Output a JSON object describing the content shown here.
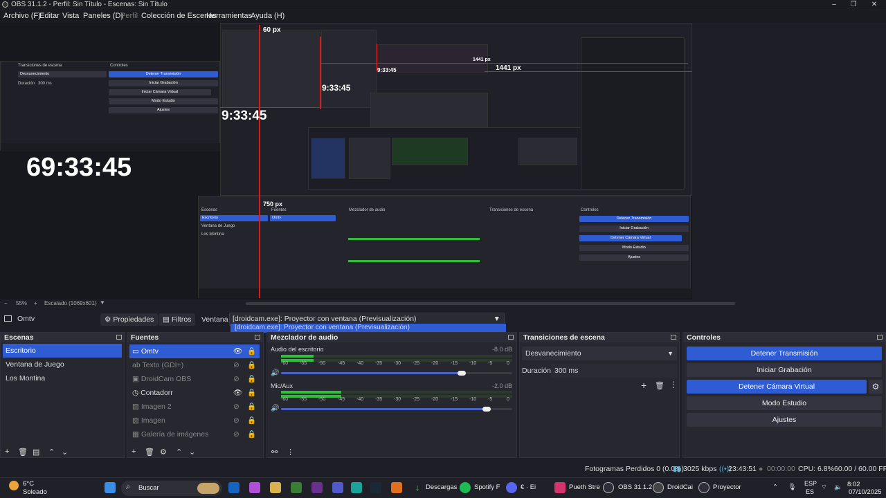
{
  "window": {
    "title": "OBS 31.1.2 - Perfil: Sin Título - Escenas: Sin Título"
  },
  "menu": [
    "Archivo (F)",
    "Editar",
    "Vista",
    "Paneles (D)",
    "Perfil",
    "Colección de Escenas",
    "Herramientas",
    "Ayuda (H)"
  ],
  "preview": {
    "clock_large": "69:33:45",
    "clock_medium": "9:33:45",
    "clock_small": "9:33:45",
    "clock_tiny": "9:33:45",
    "measure_top": "60 px",
    "measure_right": "1441 px",
    "measure_bottom": "750 px",
    "measure_mid": "1441 px"
  },
  "zoom": {
    "level": "55%",
    "scaling": "Escalado (1069x601)"
  },
  "context": {
    "source_name": "Omtv",
    "properties_label": "Propiedades",
    "filters_label": "Filtros",
    "window_label": "Ventana",
    "window_value": "[droidcam.exe]: Proyector con ventana (Previsualización)",
    "dropdown_option": "[droidcam.exe]: Proyector con ventana (Previsualización)"
  },
  "docks": {
    "scenes": {
      "title": "Escenas",
      "items": [
        "Escritorio",
        "Ventana de Juego",
        "Los Montina"
      ]
    },
    "sources": {
      "title": "Fuentes",
      "items": [
        {
          "name": "Omtv",
          "icon": "monitor-icon"
        },
        {
          "name": "Texto (GDI+)",
          "icon": "text-icon"
        },
        {
          "name": "DroidCam OBS",
          "icon": "camera-icon"
        },
        {
          "name": "Contadorr",
          "icon": "clock-icon"
        },
        {
          "name": "Imagen 2",
          "icon": "image-icon"
        },
        {
          "name": "Imagen",
          "icon": "image-icon"
        },
        {
          "name": "Galería de imágenes",
          "icon": "gallery-icon"
        }
      ]
    },
    "mixer": {
      "title": "Mezclador de audio",
      "channels": [
        {
          "name": "Audio del escritorio",
          "db": "-8.0 dB",
          "level": 0.14,
          "volume": 0.78
        },
        {
          "name": "Mic/Aux",
          "db": "-2.0 dB",
          "level": 0.26,
          "volume": 0.89
        }
      ],
      "ticks": [
        "-60",
        "-55",
        "-50",
        "-45",
        "-40",
        "-35",
        "-30",
        "-25",
        "-20",
        "-15",
        "-10",
        "-5",
        "0"
      ]
    },
    "transitions": {
      "title": "Transiciones de escena",
      "transition": "Desvanecimiento",
      "duration_label": "Duración",
      "duration_value": "300 ms"
    },
    "controls": {
      "title": "Controles",
      "buttons": [
        "Detener Transmisión",
        "Iniciar Grabación",
        "Detener Cámara Virtual",
        "Modo Estudio",
        "Ajustes"
      ]
    }
  },
  "status": {
    "dropped_frames": "Fotogramas Perdidos 0 (0.0%)",
    "bitrate": "3025 kbps",
    "stream_time": "23:43:51",
    "rec_time": "00:00:00",
    "cpu": "CPU: 6.8%",
    "fps": "60.00 / 60.00 FPS"
  },
  "taskbar": {
    "weather_temp": "6°C",
    "weather_desc": "Soleado",
    "search": "Buscar",
    "apps": [
      "Descargas",
      "Spotify F",
      "€ · Ei",
      "Pueth Stre",
      "OBS 31.1.2",
      "DroidCai",
      "Proyector"
    ],
    "lang_top": "ESP",
    "lang_bottom": "ES",
    "time": "8:02",
    "date": "07/10/2025"
  },
  "colors": {
    "accent": "#2f5bd3",
    "measure": "#e01a1a",
    "meter_green": "#2fbf3a",
    "meter_yellow": "#c9b22a",
    "meter_red": "#c82a2a"
  }
}
